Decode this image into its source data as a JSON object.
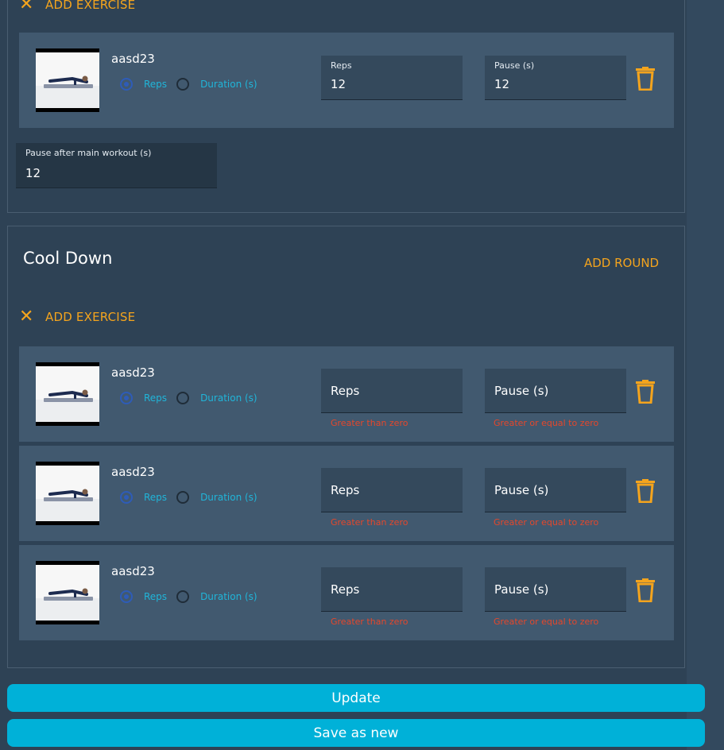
{
  "main_workout": {
    "add_exercise_label": "ADD EXERCISE",
    "exercise": {
      "name": "aasd23",
      "radio_reps_label": "Reps",
      "radio_duration_label": "Duration (s)",
      "reps_label": "Reps",
      "reps_value": "12",
      "pause_label": "Pause (s)",
      "pause_value": "12"
    },
    "pause_after_label": "Pause after main workout (s)",
    "pause_after_value": "12"
  },
  "cool_down": {
    "title": "Cool Down",
    "add_round_label": "ADD ROUND",
    "add_exercise_label": "ADD EXERCISE",
    "exercises": [
      {
        "name": "aasd23",
        "radio_reps_label": "Reps",
        "radio_duration_label": "Duration (s)",
        "reps_placeholder": "Reps",
        "reps_error": "Greater than zero",
        "pause_placeholder": "Pause (s)",
        "pause_error": "Greater or equal to zero"
      },
      {
        "name": "aasd23",
        "radio_reps_label": "Reps",
        "radio_duration_label": "Duration (s)",
        "reps_placeholder": "Reps",
        "reps_error": "Greater than zero",
        "pause_placeholder": "Pause (s)",
        "pause_error": "Greater or equal to zero"
      },
      {
        "name": "aasd23",
        "radio_reps_label": "Reps",
        "radio_duration_label": "Duration (s)",
        "reps_placeholder": "Reps",
        "reps_error": "Greater than zero",
        "pause_placeholder": "Pause (s)",
        "pause_error": "Greater or equal to zero"
      }
    ]
  },
  "actions": {
    "update_label": "Update",
    "save_as_new_label": "Save as new"
  },
  "colors": {
    "accent": "#f4a41d",
    "button": "#00b1d8",
    "error": "#e5472b",
    "radio_label": "#20b5d9"
  },
  "icons": [
    "close-icon",
    "trash-icon",
    "exercise-thumbnail"
  ]
}
